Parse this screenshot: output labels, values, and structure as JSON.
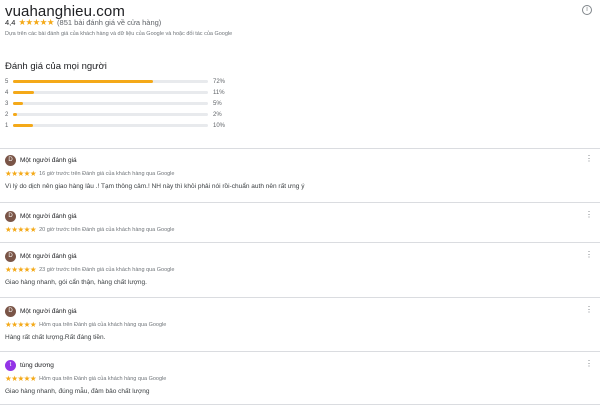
{
  "header": {
    "title": "vuahanghieu.com",
    "info_icon": "info-icon",
    "rating": "4,4",
    "stars": "★★★★★",
    "reviews_count": "(851 bài đánh giá về cửa hàng)",
    "source_note": "Dựa trên các bài đánh giá của khách hàng và dữ liệu của Google và hoặc đối tác của Google"
  },
  "distribution": {
    "title": "Đánh giá của mọi người",
    "rows": [
      {
        "label": "5",
        "pct_label": "72%",
        "value": 72
      },
      {
        "label": "4",
        "pct_label": "11%",
        "value": 11
      },
      {
        "label": "3",
        "pct_label": "5%",
        "value": 5
      },
      {
        "label": "2",
        "pct_label": "2%",
        "value": 2
      },
      {
        "label": "1",
        "pct_label": "10%",
        "value": 10
      }
    ]
  },
  "colors": {
    "star": "#f4a918",
    "avatar_brown": "#7a5547",
    "avatar_purple": "#9334e6"
  },
  "reviews": [
    {
      "initial": "D",
      "name": "Một người đánh giá",
      "stars": "★★★★★",
      "meta": "16 giờ trước trên Đánh giá của khách hàng qua Google",
      "text": "Vì lý do dịch nên giao hàng lâu .! Tạm thông cảm.! NH này thì khỏi phải nói rồi-chuẩn auth nên rất ưng ý"
    },
    {
      "initial": "D",
      "name": "Một người đánh giá",
      "stars": "★★★★★",
      "meta": "20 giờ trước trên Đánh giá của khách hàng qua Google",
      "text": ""
    },
    {
      "initial": "D",
      "name": "Một người đánh giá",
      "stars": "★★★★★",
      "meta": "23 giờ trước trên Đánh giá của khách hàng qua Google",
      "text": "Giao hàng nhanh, gói cẩn thận, hàng chất lượng."
    },
    {
      "initial": "D",
      "name": "Một người đánh giá",
      "stars": "★★★★★",
      "meta": "Hôm qua trên Đánh giá của khách hàng qua Google",
      "text": "Hàng rất chất lượng.Rất đáng tiền."
    },
    {
      "initial": "t",
      "name": "tùng dương",
      "stars": "★★★★★",
      "meta": "Hôm qua trên Đánh giá của khách hàng qua Google",
      "text": "Giao hàng nhanh, đúng mẫu, đảm bảo chất lượng"
    }
  ],
  "more_icon": "⋮"
}
